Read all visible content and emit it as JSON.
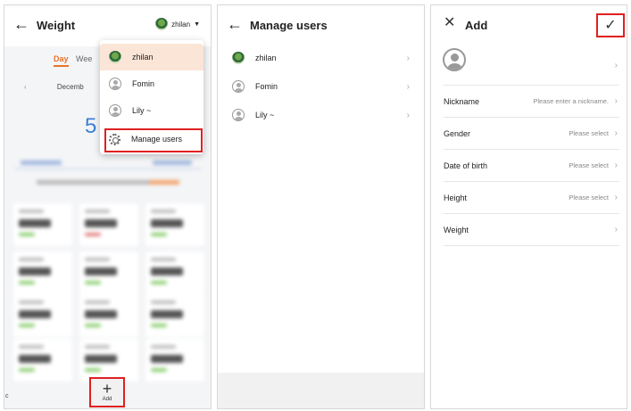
{
  "panel1": {
    "title": "Weight",
    "current_user": "zhilan",
    "tabs": [
      "Day",
      "Wee"
    ],
    "date_partial": "Decemb",
    "big_value_partial": "5",
    "bottom_left_char": "c",
    "dropdown": {
      "users": [
        "zhilan",
        "Fomin",
        "Lily ~"
      ],
      "manage_label": "Manage users"
    }
  },
  "panel2": {
    "title": "Manage users",
    "users": [
      "zhilan",
      "Fomin",
      "Lily ~"
    ],
    "add_label": "Add",
    "add_symbol": "+"
  },
  "panel3": {
    "title": "Add",
    "check_symbol": "✓",
    "close_symbol": "✕",
    "rows": [
      {
        "label": "Nickname",
        "value": "Please enter a nickname."
      },
      {
        "label": "Gender",
        "value": "Please select"
      },
      {
        "label": "Date of birth",
        "value": "Please select"
      },
      {
        "label": "Height",
        "value": "Please select"
      },
      {
        "label": "Weight",
        "value": ""
      }
    ]
  },
  "icons": {
    "back": "arrow-left-icon",
    "chevron": "chevron-right-icon",
    "highlight_color": "#e02020",
    "accent": "#e8732a",
    "value_blue": "#3b7fd6"
  }
}
